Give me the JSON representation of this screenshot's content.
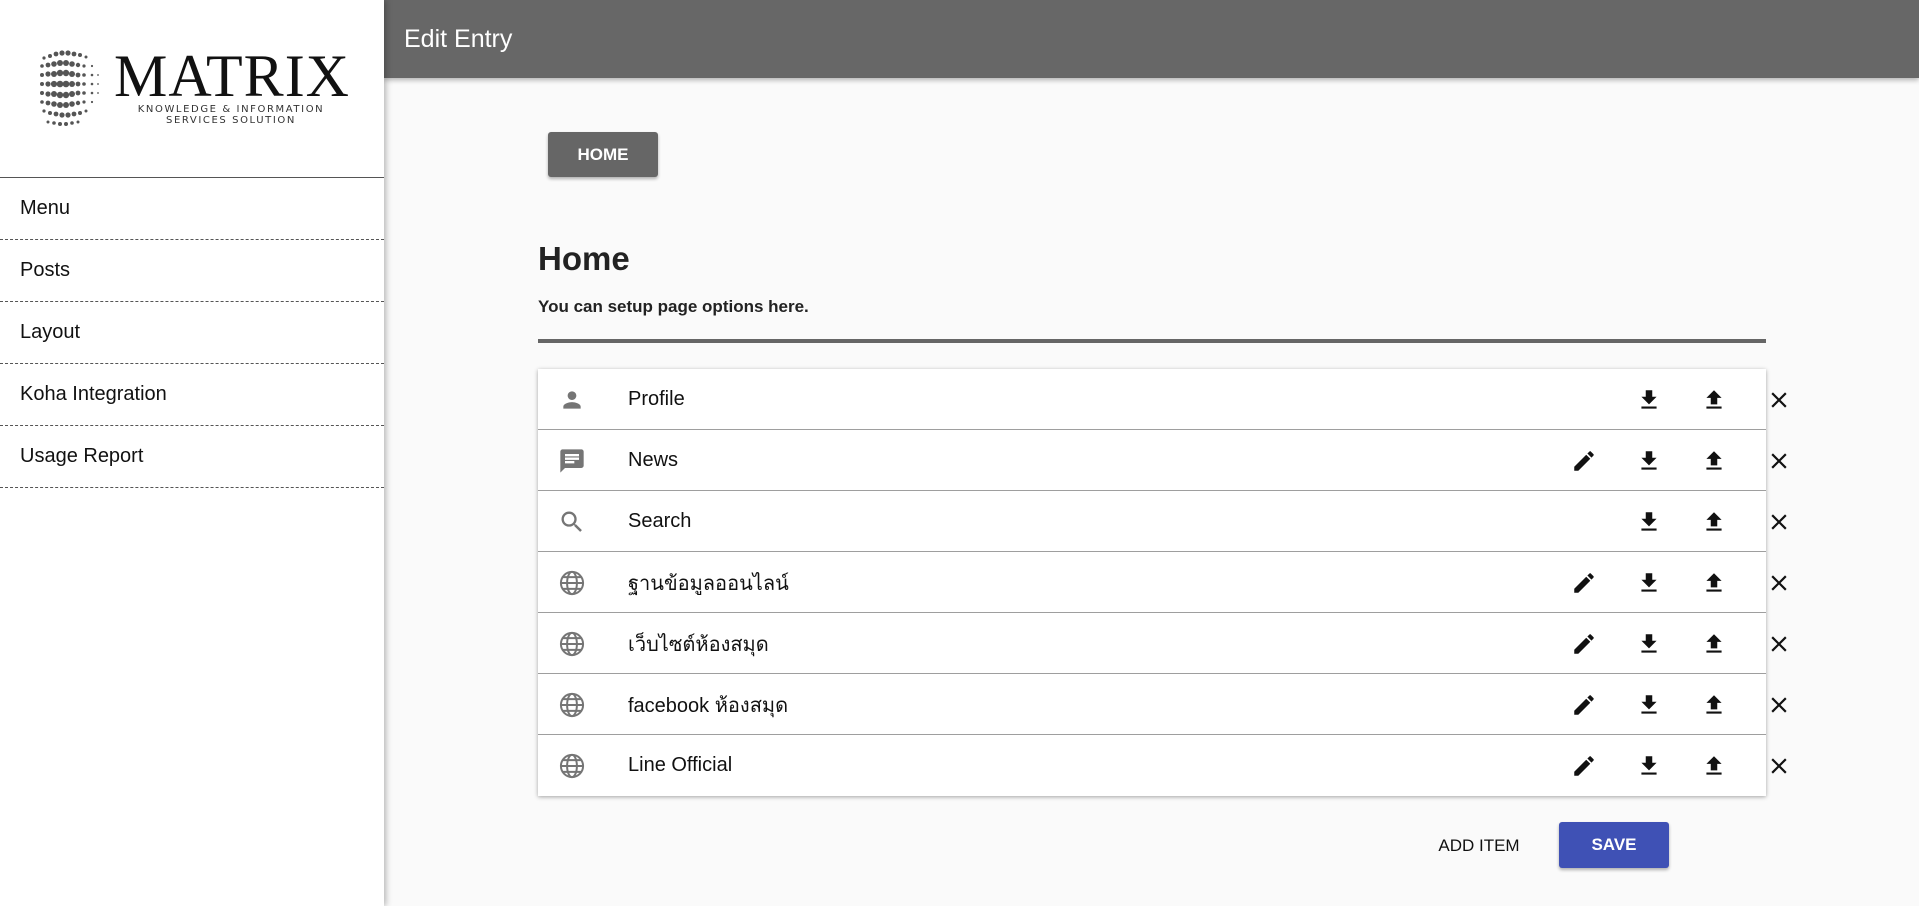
{
  "brand": {
    "name": "MATRIX",
    "tagline_1": "KNOWLEDGE & INFORMATION",
    "tagline_2": "SERVICES SOLUTION"
  },
  "sidebar": {
    "items": [
      {
        "label": "Menu"
      },
      {
        "label": "Posts"
      },
      {
        "label": "Layout"
      },
      {
        "label": "Koha Integration"
      },
      {
        "label": "Usage Report"
      }
    ]
  },
  "header": {
    "title": "Edit Entry"
  },
  "main": {
    "breadcrumb_button": "HOME",
    "title": "Home",
    "subtitle": "You can setup page options here.",
    "entries": [
      {
        "icon": "person-icon",
        "label": "Profile",
        "editable": false
      },
      {
        "icon": "comment-icon",
        "label": "News",
        "editable": true
      },
      {
        "icon": "search-icon",
        "label": "Search",
        "editable": false
      },
      {
        "icon": "globe-icon",
        "label": "ฐานข้อมูลออนไลน์",
        "editable": true
      },
      {
        "icon": "globe-icon",
        "label": "เว็บไซต์ห้องสมุด",
        "editable": true
      },
      {
        "icon": "globe-icon",
        "label": "facebook ห้องสมุด",
        "editable": true
      },
      {
        "icon": "globe-icon",
        "label": "Line Official",
        "editable": true
      }
    ],
    "add_item_label": "ADD ITEM",
    "save_label": "SAVE"
  },
  "colors": {
    "header_bg": "#676767",
    "home_button_bg": "#666666",
    "save_button_bg": "#3f51b5",
    "icon_gray": "#757575"
  }
}
